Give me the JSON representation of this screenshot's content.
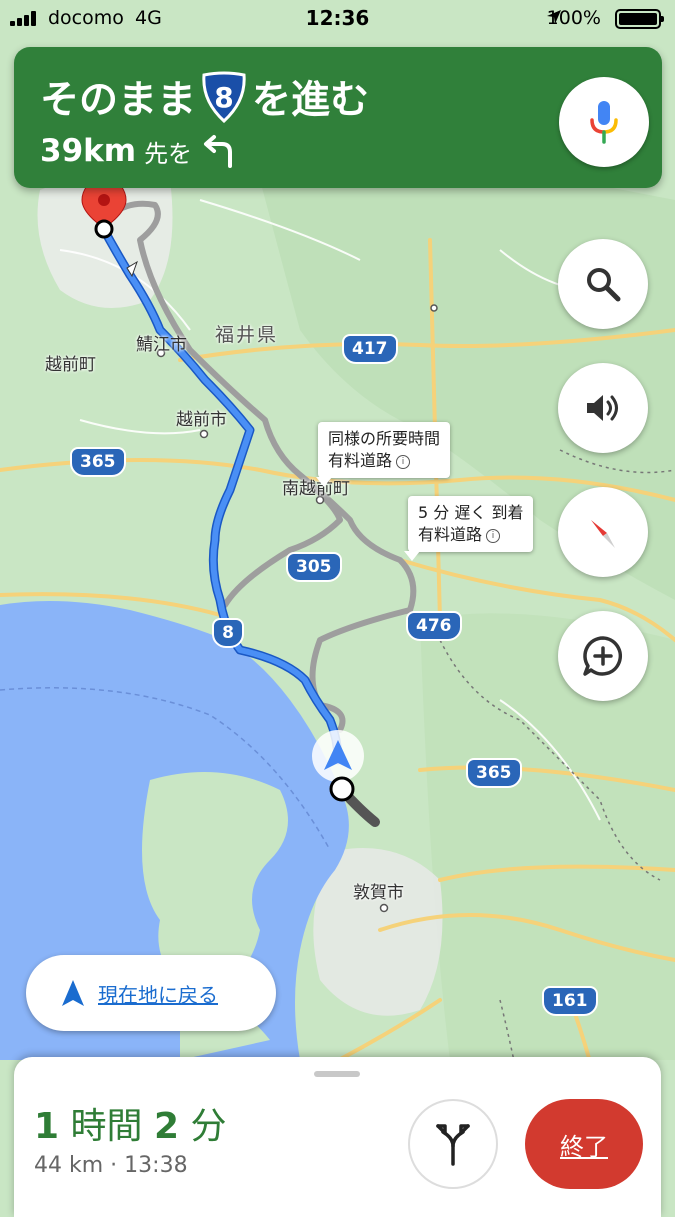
{
  "status_bar": {
    "carrier": "docomo",
    "network": "4G",
    "time": "12:36",
    "battery_percent": "100%",
    "battery_level": 1.0
  },
  "nav_banner": {
    "instruction_prefix": "そのまま",
    "route_number": "8",
    "instruction_suffix": "を進む",
    "distance": "39km",
    "distance_suffix": "先を",
    "next_turn": "turn-left-icon",
    "mic_icon": "microphone-icon"
  },
  "map": {
    "labels": {
      "prefecture": "福井県",
      "sabae": "鯖江市",
      "echizen_cho": "越前町",
      "echizen_shi": "越前市",
      "minami_echizen": "南越前町",
      "tsuruga": "敦賀市",
      "fukui_partial": "福井"
    },
    "route_shields": {
      "r417": "417",
      "r365a": "365",
      "r305": "305",
      "r8": "8",
      "r476": "476",
      "r365b": "365",
      "r161": "161"
    },
    "callouts": {
      "alt1_line1": "同様の所要時間",
      "alt1_line2": "有料道路",
      "alt2_line1": "5 分 遅く 到着",
      "alt2_line2": "有料道路"
    },
    "colors": {
      "route_primary": "#4285f4",
      "route_alternate": "#9e9e9e",
      "water": "#8ab4f8",
      "land": "#c9e6c4",
      "destination_pin": "#ea4335"
    }
  },
  "controls": {
    "search_icon": "search-icon",
    "sound_icon": "speaker-icon",
    "compass_icon": "compass-icon",
    "report_icon": "add-report-icon"
  },
  "recenter": {
    "label": "現在地に戻る"
  },
  "trip": {
    "hours": "1",
    "hours_unit": "時間",
    "minutes": "2",
    "minutes_unit": "分",
    "distance": "44 km",
    "separator": "·",
    "arrival_time": "13:38",
    "alternate_routes_icon": "alternate-routes-icon",
    "exit_label": "終了"
  }
}
